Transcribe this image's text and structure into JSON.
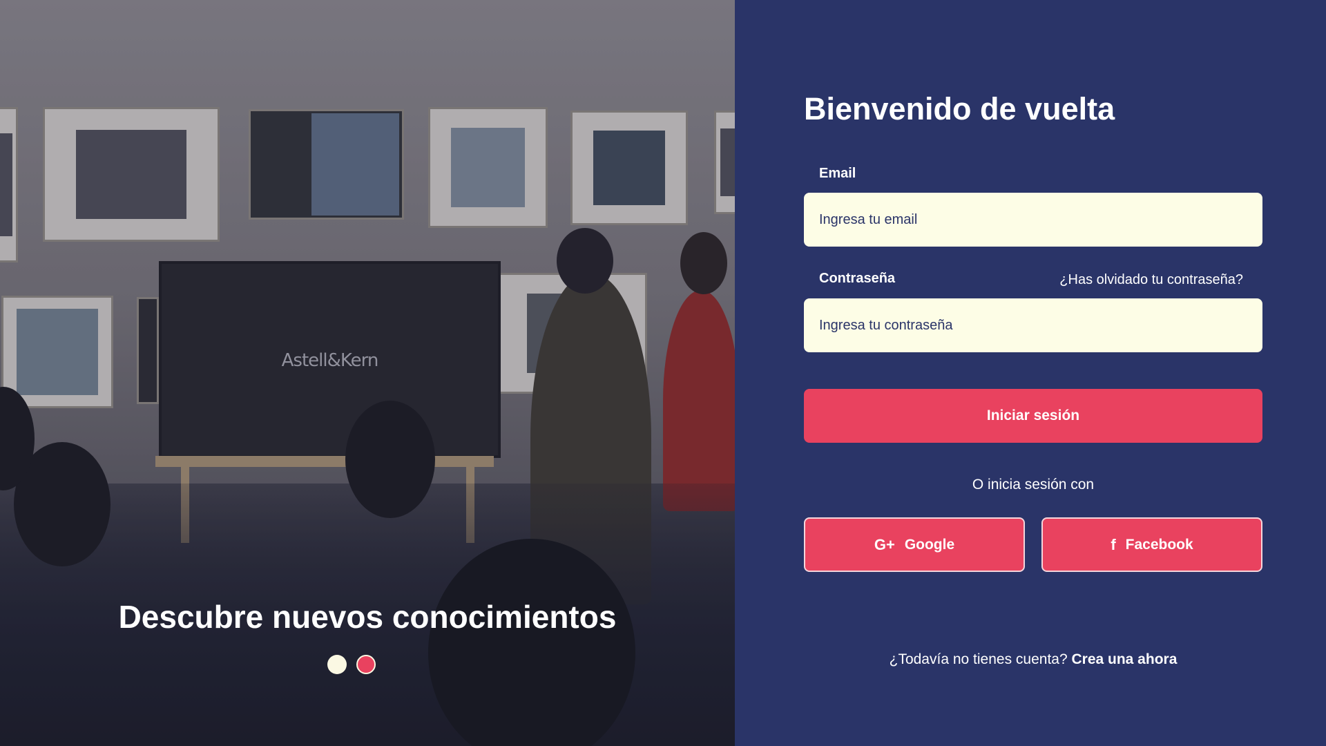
{
  "hero": {
    "image_alt": "Presentation in a gallery room",
    "tv_brand": "Astell&Kern",
    "caption": "Descubre nuevos conocimientos",
    "carousel": {
      "count": 2,
      "active_index": 1
    }
  },
  "login": {
    "title": "Bienvenido de vuelta",
    "email_label": "Email",
    "email_placeholder": "Ingresa tu email",
    "password_label": "Contraseña",
    "forgot_link": "¿Has olvidado tu contraseña?",
    "password_placeholder": "Ingresa tu contraseña",
    "submit_label": "Iniciar sesión",
    "or_text": "O inicia sesión con",
    "google_label": "Google",
    "facebook_label": "Facebook",
    "signup_prompt": "¿Todavía no tienes cuenta?",
    "signup_link": "Crea una ahora"
  },
  "colors": {
    "panel_bg": "#2a3468",
    "accent": "#e9425f",
    "input_bg": "#fdfde6"
  },
  "icons": {
    "google": "google-plus-icon",
    "facebook": "facebook-icon"
  }
}
